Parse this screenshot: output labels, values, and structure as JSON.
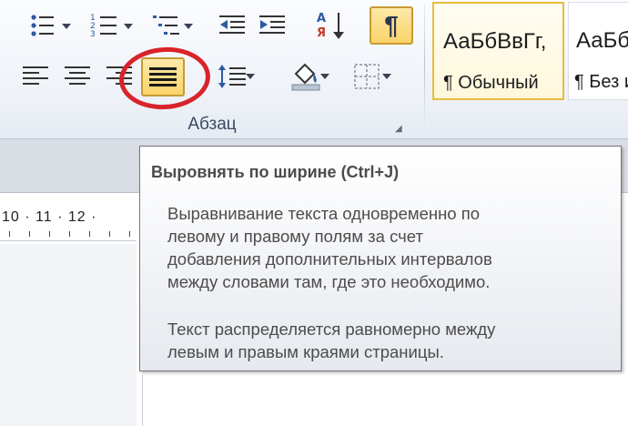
{
  "ribbon": {
    "paragraph_group_label": "Абзац",
    "show_marks_glyph": "¶",
    "buttons": {
      "bullets": "bullet-list-icon",
      "numbering": "numbered-list-icon",
      "multilevel": "multilevel-list-icon",
      "decrease_indent": "decrease-indent-icon",
      "increase_indent": "increase-indent-icon",
      "sort": "sort-icon",
      "align_left": "align-left-icon",
      "align_center": "align-center-icon",
      "align_right": "align-right-icon",
      "justify": "justify-icon",
      "line_spacing": "line-spacing-icon",
      "shading": "shading-icon",
      "borders": "borders-icon"
    },
    "sort_letters": {
      "top": "А",
      "bottom": "Я"
    }
  },
  "styles": [
    {
      "sample": "АаБбВвГг,",
      "name": "¶ Обычный",
      "selected": true
    },
    {
      "sample": "АаБб",
      "name": "¶ Без и",
      "selected": false
    }
  ],
  "ruler": {
    "text": "10 · 11 · 12 ·"
  },
  "tooltip": {
    "title": "Выровнять по ширине (Ctrl+J)",
    "paragraph1": [
      "Выравнивание текста одновременно по",
      "левому и правому полям за счет",
      "добавления дополнительных интервалов",
      "между словами там, где это необходимо."
    ],
    "paragraph2": [
      "Текст распределяется равномерно между",
      "левым и правым краями страницы."
    ]
  },
  "colors": {
    "highlight_fill": "#fbd36a",
    "highlight_border": "#c79a35",
    "annotation_ring": "#d9232b",
    "tooltip_text": "#4c4c4c"
  }
}
